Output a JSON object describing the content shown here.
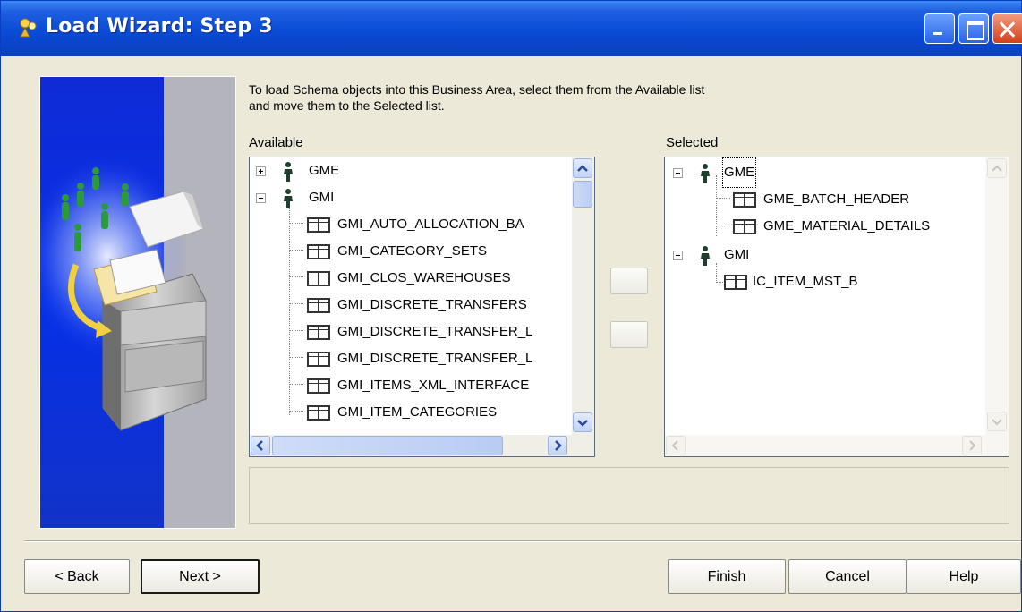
{
  "window": {
    "title": "Load Wizard: Step 3",
    "accent": "#0a4bd6"
  },
  "instructions": {
    "line1": "To load Schema objects into this Business Area, select them from the Available list",
    "line2": "and move them to the Selected list."
  },
  "available": {
    "label": "Available",
    "items": [
      {
        "type": "schema",
        "text": "GME",
        "expander": "plus"
      },
      {
        "type": "schema",
        "text": "GMI",
        "expander": "minus"
      },
      {
        "type": "table",
        "text": "GMI_AUTO_ALLOCATION_BA"
      },
      {
        "type": "table",
        "text": "GMI_CATEGORY_SETS"
      },
      {
        "type": "table",
        "text": "GMI_CLOS_WAREHOUSES"
      },
      {
        "type": "table",
        "text": "GMI_DISCRETE_TRANSFERS"
      },
      {
        "type": "table",
        "text": "GMI_DISCRETE_TRANSFER_L"
      },
      {
        "type": "table",
        "text": "GMI_DISCRETE_TRANSFER_L"
      },
      {
        "type": "table",
        "text": "GMI_ITEMS_XML_INTERFACE"
      },
      {
        "type": "table",
        "text": "GMI_ITEM_CATEGORIES"
      }
    ]
  },
  "selected": {
    "label": "Selected",
    "items": [
      {
        "type": "schema",
        "text": "GME",
        "expander": "minus"
      },
      {
        "type": "table",
        "text": "GME_BATCH_HEADER"
      },
      {
        "type": "table",
        "text": "GME_MATERIAL_DETAILS"
      },
      {
        "type": "schema",
        "text": "GMI",
        "expander": "minus"
      },
      {
        "type": "table",
        "text": "IC_ITEM_MST_B"
      }
    ]
  },
  "move_buttons": {
    "add_icon": "arrow-right-icon",
    "remove_icon": "arrow-left-icon"
  },
  "footer": {
    "back": {
      "mnemonic": "B",
      "rest": "ack",
      "prefix": "< "
    },
    "next": {
      "mnemonic": "N",
      "rest": "ext",
      "suffix": " >"
    },
    "finish": "Finish",
    "cancel": "Cancel",
    "help": {
      "mnemonic": "H",
      "rest": "elp"
    }
  }
}
